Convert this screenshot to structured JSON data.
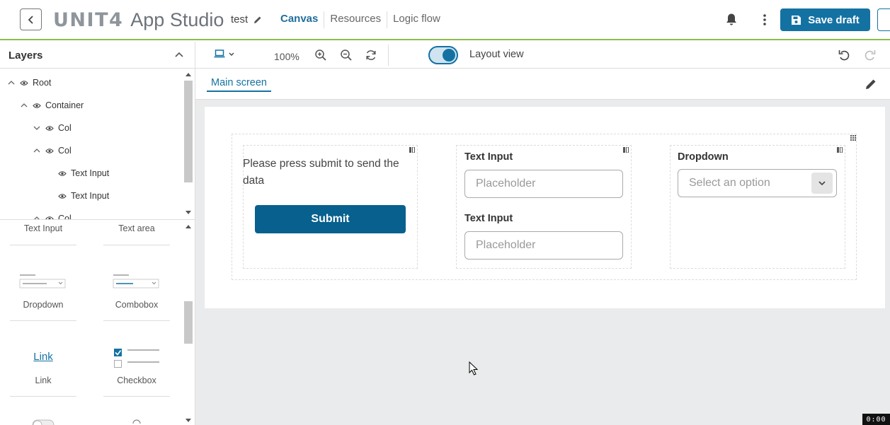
{
  "header": {
    "brand": "UNIT4",
    "product": "App Studio",
    "project_name": "test",
    "tabs": [
      {
        "label": "Canvas",
        "active": true
      },
      {
        "label": "Resources",
        "active": false
      },
      {
        "label": "Logic flow",
        "active": false
      }
    ],
    "save_label": "Save draft",
    "accent_color": "#1472a3",
    "underline_color": "#8cbd4e"
  },
  "layers": {
    "title": "Layers",
    "tree": [
      {
        "label": "Root",
        "level": 0,
        "chevron": "up"
      },
      {
        "label": "Container",
        "level": 1,
        "chevron": "up"
      },
      {
        "label": "Col",
        "level": 2,
        "chevron": "down"
      },
      {
        "label": "Col",
        "level": 2,
        "chevron": "up"
      },
      {
        "label": "Text Input",
        "level": 3,
        "chevron": "none"
      },
      {
        "label": "Text Input",
        "level": 3,
        "chevron": "none"
      },
      {
        "label": "Col",
        "level": 2,
        "chevron": "up"
      }
    ]
  },
  "components": {
    "items": [
      "Text Input",
      "Text area",
      "Dropdown",
      "Combobox",
      "Link",
      "Checkbox"
    ],
    "link_preview": "Link"
  },
  "toolbar": {
    "zoom": "100%",
    "layout_view_label": "Layout view",
    "layout_view_on": true
  },
  "screen": {
    "tab_label": "Main screen"
  },
  "canvas": {
    "info_text": "Please press submit to send the data",
    "submit_label": "Submit",
    "text_input_1": {
      "label": "Text Input",
      "placeholder": "Placeholder"
    },
    "text_input_2": {
      "label": "Text Input",
      "placeholder": "Placeholder"
    },
    "dropdown": {
      "label": "Dropdown",
      "placeholder": "Select an option"
    }
  },
  "recording": {
    "timer": "0:00"
  }
}
